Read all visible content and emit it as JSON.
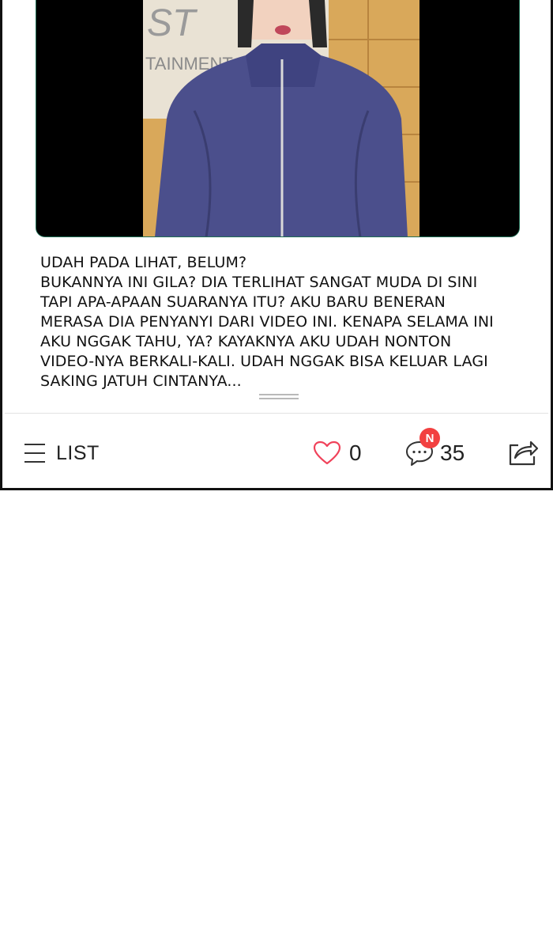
{
  "media": {
    "sign_text_top": "ST",
    "sign_text_bottom": "TAINMENT"
  },
  "caption": {
    "lines": [
      "UDAH PADA LIHAT, BELUM?",
      "BUKANNYA INI GILA? DIA TERLIHAT SANGAT MUDA DI SINI",
      "TAPI APA-APAAN SUARANYA ITU? AKU BARU BENERAN",
      "MERASA DIA PENYANYI DARI VIDEO INI. KENAPA SELAMA INI",
      "AKU NGGAK TAHU, YA? KAYAKNYA AKU UDAH NONTON",
      "VIDEO-NYA BERKALI-KALI. UDAH NGGAK BISA KELUAR LAGI",
      "SAKING JATUH CINTANYA..."
    ]
  },
  "actionbar": {
    "list_label": "LIST",
    "list_icon": "hamburger-menu-icon",
    "like_icon": "heart-outline-icon",
    "like_count": "0",
    "comment_icon": "speech-bubble-icon",
    "comment_badge": "N",
    "comment_count": "35",
    "share_icon": "share-arrow-icon"
  },
  "colors": {
    "like_icon": "#f0425a",
    "badge": "#f24040",
    "media_frame": "#1f6e55"
  }
}
